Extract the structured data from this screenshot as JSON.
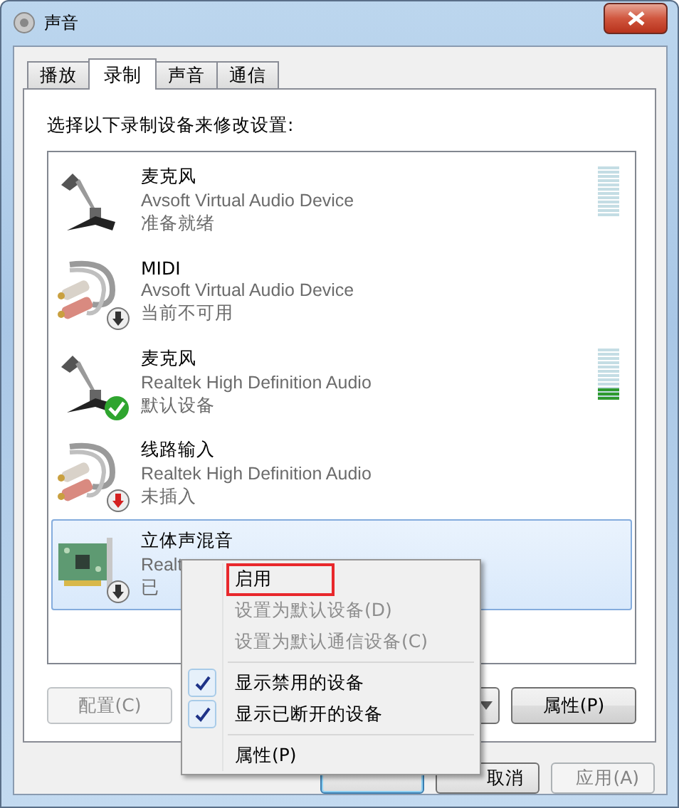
{
  "window": {
    "title": "声音"
  },
  "tabs": [
    {
      "label": "播放",
      "selected": false
    },
    {
      "label": "录制",
      "selected": true
    },
    {
      "label": "声音",
      "selected": false
    },
    {
      "label": "通信",
      "selected": false
    }
  ],
  "instruction": "选择以下录制设备来修改设置:",
  "devices": [
    {
      "kind": "mic",
      "name": "麦克风",
      "description": "Avsoft Virtual Audio Device",
      "status": "准备就绪",
      "disabled": false,
      "default": false,
      "unplugged": false,
      "meter": true,
      "level": 0,
      "selected": false
    },
    {
      "kind": "cable",
      "name": "MIDI",
      "description": "Avsoft Virtual Audio Device",
      "status": "当前不可用",
      "disabled": true,
      "default": false,
      "unplugged": false,
      "meter": false,
      "selected": false
    },
    {
      "kind": "mic",
      "name": "麦克风",
      "description": "Realtek High Definition Audio",
      "status": "默认设备",
      "disabled": false,
      "default": true,
      "unplugged": false,
      "meter": true,
      "level": 0.25,
      "selected": false
    },
    {
      "kind": "cable",
      "name": "线路输入",
      "description": "Realtek High Definition Audio",
      "status": "未插入",
      "disabled": false,
      "default": false,
      "unplugged": true,
      "meter": false,
      "selected": false
    },
    {
      "kind": "card",
      "name": "立体声混音",
      "description": "Realt",
      "status": "已",
      "disabled": true,
      "default": false,
      "unplugged": false,
      "meter": false,
      "selected": true
    }
  ],
  "panel_buttons": [
    {
      "kind": "button",
      "label": "配置(C)",
      "disabled": true
    },
    {
      "kind": "split"
    },
    {
      "kind": "button",
      "label": "属性(P)",
      "disabled": false
    }
  ],
  "dialog_buttons": [
    {
      "disabled": false,
      "default": true
    },
    {
      "label": "取消",
      "disabled": false,
      "default": false
    },
    {
      "label": "应用(A)",
      "disabled": true,
      "default": false
    }
  ],
  "context_menu": {
    "items": [
      {
        "kind": "item",
        "label": "启用",
        "disabled": false,
        "outlined": true
      },
      {
        "kind": "item",
        "label": "设置为默认设备(D)",
        "disabled": true,
        "outlined": false
      },
      {
        "kind": "item",
        "label": "设置为默认通信设备(C)",
        "disabled": true,
        "outlined": false
      },
      {
        "kind": "separator"
      },
      {
        "kind": "check",
        "label": "显示禁用的设备",
        "checked": true
      },
      {
        "kind": "check",
        "label": "显示已断开的设备",
        "checked": true
      },
      {
        "kind": "separator"
      },
      {
        "kind": "item",
        "label": "属性(P)",
        "disabled": false,
        "outlined": false
      }
    ]
  }
}
